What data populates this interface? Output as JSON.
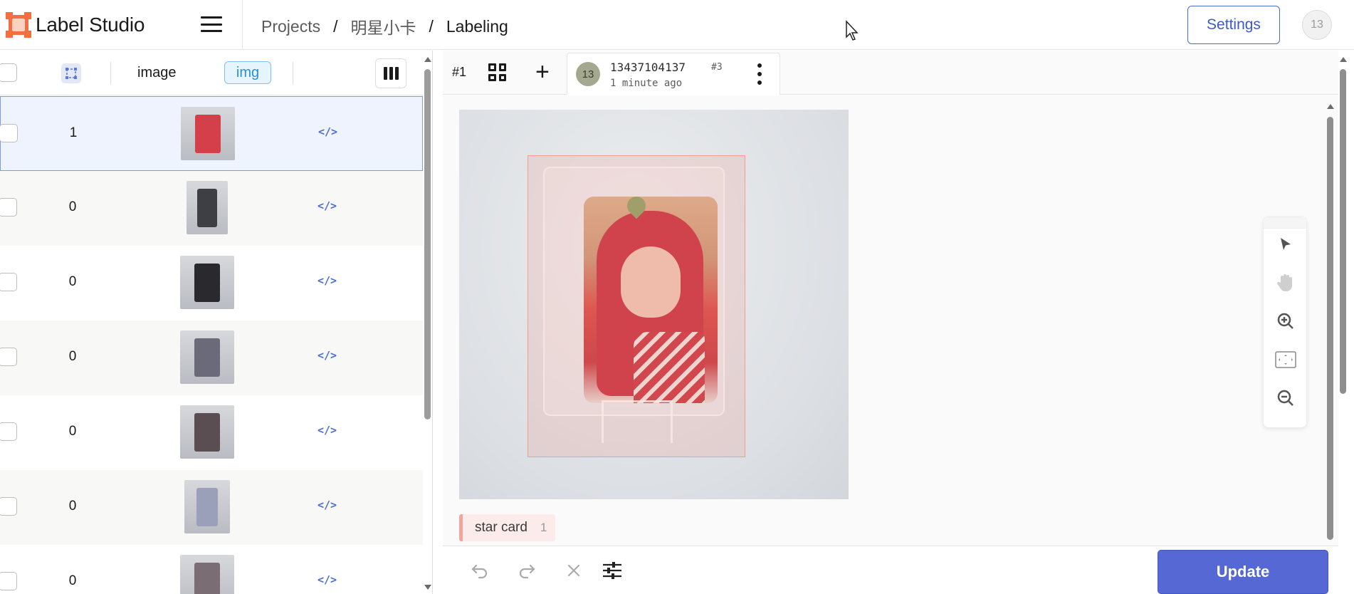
{
  "app": {
    "name": "Label Studio"
  },
  "header": {
    "breadcrumb": [
      "Projects",
      "明星小卡",
      "Labeling"
    ],
    "breadcrumb_separator": "/",
    "settings_label": "Settings",
    "user_initials": "13"
  },
  "table": {
    "columns": {
      "image_label": "image",
      "img_badge": "img"
    },
    "rows": [
      {
        "count": "1",
        "selected": true,
        "thumb_color": "#d3404a"
      },
      {
        "count": "0",
        "selected": false,
        "thumb_color": "#3e3f44"
      },
      {
        "count": "0",
        "selected": false,
        "thumb_color": "#2a2a2e"
      },
      {
        "count": "0",
        "selected": false,
        "thumb_color": "#6a6a78"
      },
      {
        "count": "0",
        "selected": false,
        "thumb_color": "#5a4e52"
      },
      {
        "count": "0",
        "selected": false,
        "thumb_color": "#9aa0b8"
      },
      {
        "count": "0",
        "selected": false,
        "thumb_color": "#7a6e74"
      }
    ],
    "code_icon": "</>"
  },
  "annotation": {
    "task_id": "#1",
    "annotator_initials": "13",
    "annotator": "13437104137",
    "annotation_id": "#3",
    "time": "1 minute ago"
  },
  "region": {
    "label": "star card",
    "count": "1",
    "color": "#f4a49a"
  },
  "controls": {
    "update_label": "Update"
  },
  "colors": {
    "accent": "#5568d3",
    "brand": "#f36f42",
    "link": "#4b6fd0"
  }
}
